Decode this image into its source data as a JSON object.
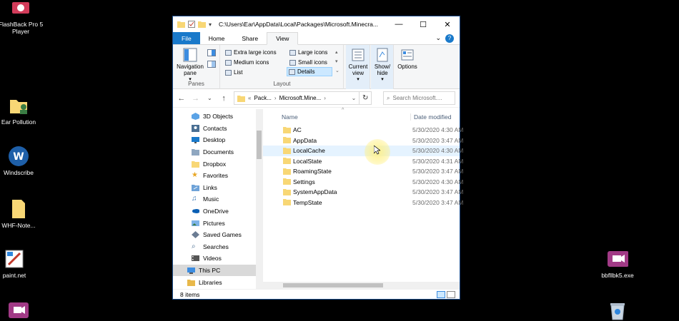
{
  "desktop": {
    "icons": [
      {
        "label": "FlashBack Pro 5 Player",
        "icon": "flashback-icon"
      },
      {
        "label": "Ear Pollution",
        "icon": "folder-person-icon"
      },
      {
        "label": "Windscribe",
        "icon": "windscribe-icon"
      },
      {
        "label": "WHF-Note...",
        "icon": "file-icon"
      },
      {
        "label": "paint.net",
        "icon": "paint-icon"
      },
      {
        "label": "bbfllbk5.exe",
        "icon": "camera-app-icon"
      }
    ]
  },
  "window": {
    "title_path": "C:\\Users\\Ear\\AppData\\Local\\Packages\\Microsoft.Minecra...",
    "controls": {
      "minimize": "—",
      "maximize": "☐",
      "close": "✕"
    },
    "tabs": [
      "File",
      "Home",
      "Share",
      "View"
    ],
    "active_tab": "View",
    "ribbon": {
      "panes": {
        "nav_pane": "Navigation pane",
        "group_label": "Panes"
      },
      "layout": {
        "items": [
          "Extra large icons",
          "Large icons",
          "Medium icons",
          "Small icons",
          "List",
          "Details"
        ],
        "selected": "Details",
        "group_label": "Layout"
      },
      "current_view": "Current view",
      "show_hide": "Show/ hide",
      "options": "Options"
    },
    "address": {
      "crumbs": [
        "Pack...",
        "Microsoft.Mine..."
      ],
      "search_placeholder": "Search Microsoft...."
    },
    "nav_items": [
      {
        "label": "3D Objects",
        "icon": "3d-objects-icon"
      },
      {
        "label": "Contacts",
        "icon": "contacts-icon"
      },
      {
        "label": "Desktop",
        "icon": "desktop-icon"
      },
      {
        "label": "Documents",
        "icon": "documents-icon"
      },
      {
        "label": "Dropbox",
        "icon": "dropbox-folder-icon"
      },
      {
        "label": "Favorites",
        "icon": "star-icon"
      },
      {
        "label": "Links",
        "icon": "links-icon"
      },
      {
        "label": "Music",
        "icon": "music-icon"
      },
      {
        "label": "OneDrive",
        "icon": "cloud-icon"
      },
      {
        "label": "Pictures",
        "icon": "pictures-icon"
      },
      {
        "label": "Saved Games",
        "icon": "games-icon"
      },
      {
        "label": "Searches",
        "icon": "search-icon"
      },
      {
        "label": "Videos",
        "icon": "videos-icon"
      },
      {
        "label": "This PC",
        "icon": "pc-icon"
      },
      {
        "label": "Libraries",
        "icon": "libraries-icon"
      }
    ],
    "selected_nav": "This PC",
    "columns": {
      "name": "Name",
      "date": "Date modified"
    },
    "files": [
      {
        "name": "AC",
        "date": "5/30/2020 4:30 AM"
      },
      {
        "name": "AppData",
        "date": "5/30/2020 3:47 AM"
      },
      {
        "name": "LocalCache",
        "date": "5/30/2020 4:30 AM"
      },
      {
        "name": "LocalState",
        "date": "5/30/2020 4:31 AM"
      },
      {
        "name": "RoamingState",
        "date": "5/30/2020 3:47 AM"
      },
      {
        "name": "Settings",
        "date": "5/30/2020 4:30 AM"
      },
      {
        "name": "SystemAppData",
        "date": "5/30/2020 3:47 AM"
      },
      {
        "name": "TempState",
        "date": "5/30/2020 3:47 AM"
      }
    ],
    "hovered_file": "LocalCache",
    "status": "8 items"
  },
  "colors": {
    "accent": "#1979ca",
    "folder": "#f8d775",
    "selection": "#cce8ff"
  }
}
